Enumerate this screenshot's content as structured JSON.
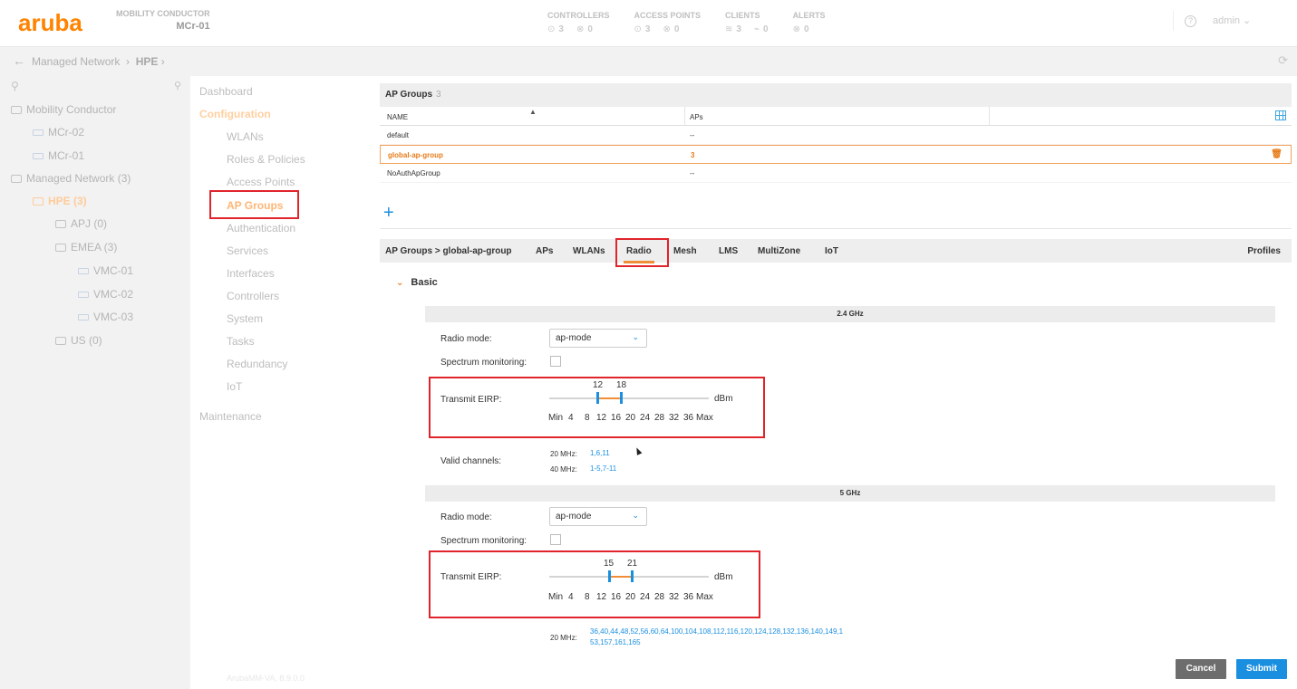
{
  "header": {
    "logo": "aruba",
    "mc_label": "MOBILITY CONDUCTOR",
    "mc_name": "MCr-01",
    "stats": [
      {
        "title": "CONTROLLERS",
        "ok": "3",
        "alert": "0"
      },
      {
        "title": "ACCESS POINTS",
        "ok": "3",
        "alert": "0"
      },
      {
        "title": "CLIENTS",
        "ok": "3",
        "alert": "0"
      },
      {
        "title": "ALERTS",
        "ok": "0",
        "alert": ""
      }
    ],
    "user": "admin"
  },
  "breadcrumb": {
    "path": "Managed Network",
    "current": "HPE"
  },
  "tree": {
    "items": [
      {
        "label": "Mobility Conductor"
      },
      {
        "label": "MCr-02"
      },
      {
        "label": "MCr-01"
      },
      {
        "label": "Managed Network (3)"
      },
      {
        "label": "HPE (3)"
      },
      {
        "label": "APJ (0)"
      },
      {
        "label": "EMEA (3)"
      },
      {
        "label": "VMC-01"
      },
      {
        "label": "VMC-02"
      },
      {
        "label": "VMC-03"
      },
      {
        "label": "US (0)"
      }
    ]
  },
  "nav": {
    "dashboard": "Dashboard",
    "configuration": "Configuration",
    "items": [
      "WLANs",
      "Roles & Policies",
      "Access Points",
      "AP Groups",
      "Authentication",
      "Services",
      "Interfaces",
      "Controllers",
      "System",
      "Tasks",
      "Redundancy",
      "IoT"
    ],
    "maintenance": "Maintenance",
    "version": "ArubaMM-VA, 8.9.0.0"
  },
  "ap_groups": {
    "title": "AP Groups",
    "count": "3",
    "col_name": "NAME",
    "col_aps": "APs",
    "rows": [
      {
        "name": "default",
        "aps": "--"
      },
      {
        "name": "global-ap-group",
        "aps": "3"
      },
      {
        "name": "NoAuthApGroup",
        "aps": "--"
      }
    ],
    "add": "+"
  },
  "detail": {
    "crumb": "AP Groups > global-ap-group",
    "tabs": [
      "APs",
      "WLANs",
      "Radio",
      "Mesh",
      "LMS",
      "MultiZone",
      "IoT"
    ],
    "active_tab": "Radio",
    "profiles": "Profiles",
    "section": "Basic",
    "band24": {
      "title": "2.4 GHz",
      "radio_mode_label": "Radio mode:",
      "radio_mode_value": "ap-mode",
      "spectrum_label": "Spectrum monitoring:",
      "eirp_label": "Transmit EIRP:",
      "eirp_min": "12",
      "eirp_max": "18",
      "unit": "dBm",
      "valid_label": "Valid channels:",
      "ch20_label": "20 MHz:",
      "ch20": "1,6,11",
      "ch40_label": "40 MHz:",
      "ch40": "1-5,7-11"
    },
    "band5": {
      "title": "5 GHz",
      "radio_mode_label": "Radio mode:",
      "radio_mode_value": "ap-mode",
      "spectrum_label": "Spectrum monitoring:",
      "eirp_label": "Transmit EIRP:",
      "eirp_min": "15",
      "eirp_max": "21",
      "unit": "dBm",
      "ch20_label": "20 MHz:",
      "ch20_line1": "36,40,44,48,52,56,60,64,100,104,108,112,116,120,124,128,132,136,140,149,1",
      "ch20_line2": "53,157,161,165"
    },
    "ticks": [
      "Min",
      "4",
      "8",
      "12",
      "16",
      "20",
      "24",
      "28",
      "32",
      "36",
      "Max"
    ]
  },
  "buttons": {
    "cancel": "Cancel",
    "submit": "Submit"
  },
  "colors": {
    "accent": "#f08e38",
    "link": "#1a8fe0",
    "highlight_box": "#e0242c"
  }
}
